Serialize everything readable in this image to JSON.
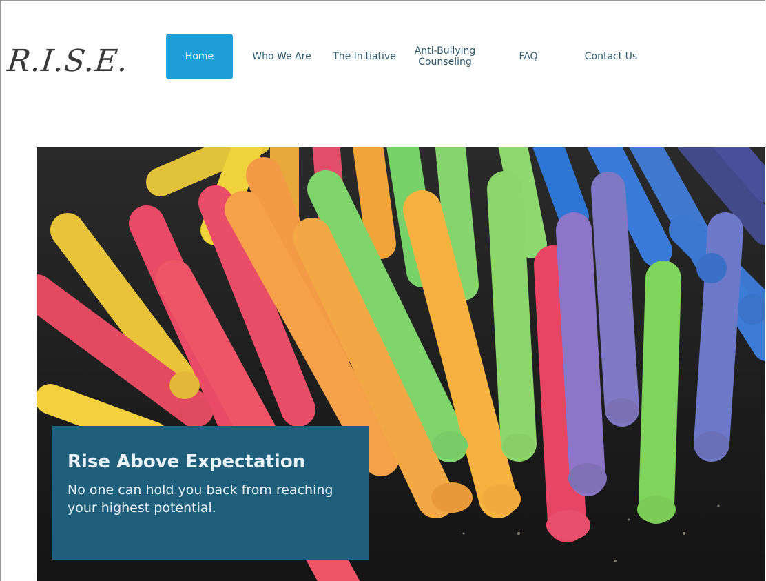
{
  "logo": {
    "text": "R.I.S.E."
  },
  "nav": {
    "items": [
      {
        "label": "Home",
        "active": true
      },
      {
        "label": "Who We Are",
        "active": false
      },
      {
        "label": "The Initiative",
        "active": false
      },
      {
        "label": "Anti-Bullying\nCounseling",
        "active": false
      },
      {
        "label": "FAQ",
        "active": false
      },
      {
        "label": "Contact Us",
        "active": false
      }
    ]
  },
  "hero": {
    "image_subject": "colorful-chalk-sticks",
    "caption": {
      "title": "Rise Above Expectation",
      "text": "No one can hold you back from reaching your highest potential."
    }
  },
  "colors": {
    "nav_active_bg": "#1f9fd9",
    "nav_text": "#2f5b72",
    "caption_bg": "#1f5f7c"
  }
}
